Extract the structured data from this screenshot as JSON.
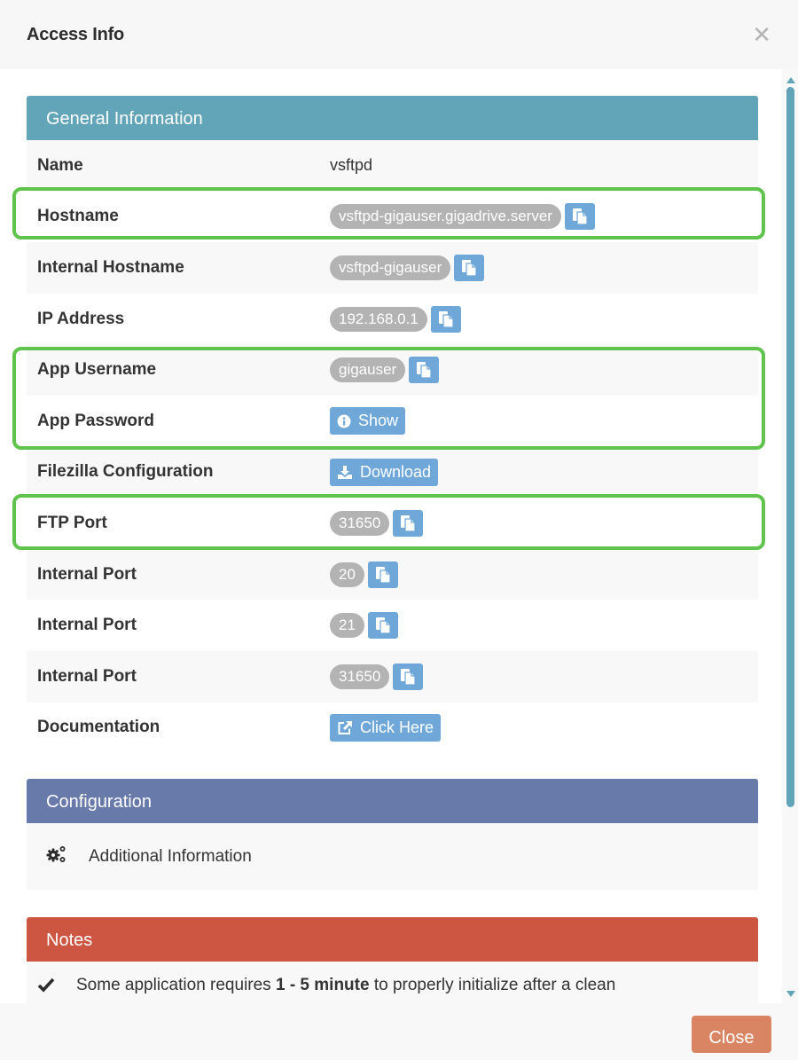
{
  "modal": {
    "title": "Access Info",
    "close_icon": "close-x-icon",
    "close_button_label": "Close"
  },
  "general": {
    "heading": "General Information",
    "rows": [
      {
        "label": "Name",
        "value": "vsftpd",
        "type": "text"
      },
      {
        "label": "Hostname",
        "value": "vsftpd-gigauser.gigadrive.server",
        "type": "badge-copy",
        "highlighted": true
      },
      {
        "label": "Internal Hostname",
        "value": "vsftpd-gigauser",
        "type": "badge-copy"
      },
      {
        "label": "IP Address",
        "value": "192.168.0.1",
        "type": "badge-copy"
      },
      {
        "label": "App Username",
        "value": "gigauser",
        "type": "badge-copy",
        "highlighted": true
      },
      {
        "label": "App Password",
        "value": "Show",
        "type": "button",
        "icon": "info-circle-icon",
        "highlighted": true
      },
      {
        "label": "Filezilla Configuration",
        "value": "Download",
        "type": "button",
        "icon": "download-icon"
      },
      {
        "label": "FTP Port",
        "value": "31650",
        "type": "badge-copy",
        "highlighted": true
      },
      {
        "label": "Internal Port",
        "value": "20",
        "type": "badge-copy"
      },
      {
        "label": "Internal Port",
        "value": "21",
        "type": "badge-copy"
      },
      {
        "label": "Internal Port",
        "value": "31650",
        "type": "badge-copy"
      },
      {
        "label": "Documentation",
        "value": "Click Here",
        "type": "button",
        "icon": "external-link-icon"
      }
    ]
  },
  "configuration": {
    "heading": "Configuration",
    "item_label": "Additional Information",
    "item_icon": "cogs-icon"
  },
  "notes": {
    "heading": "Notes",
    "item_icon": "check-icon",
    "item_prefix": "Some application requires ",
    "item_bold": "1 - 5 minute",
    "item_suffix": " to properly initialize after a clean"
  },
  "colors": {
    "general_heading": "#62a5b8",
    "config_heading": "#677aaa",
    "notes_heading": "#cd5643",
    "highlight": "#5fc44b",
    "button": "#6fa8d8",
    "badge": "#b3b3b3",
    "close_button": "#d98563"
  }
}
